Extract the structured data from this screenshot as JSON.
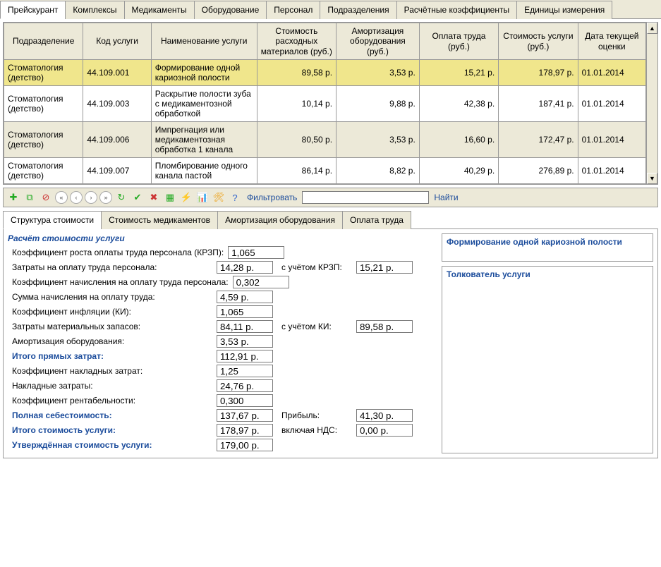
{
  "tabs": {
    "main": [
      "Прейскурант",
      "Комплексы",
      "Медикаменты",
      "Оборудование",
      "Персонал",
      "Подразделения",
      "Расчётные коэффициенты",
      "Единицы измерения"
    ],
    "sub": [
      "Структура стоимости",
      "Стоимость медикаментов",
      "Амортизация оборудования",
      "Оплата труда"
    ]
  },
  "grid": {
    "headers": [
      "Подразделение",
      "Код услуги",
      "Наименование услуги",
      "Стоимость расходных материалов (руб.)",
      "Амортизация оборудования (руб.)",
      "Оплата труда (руб.)",
      "Стоимость услуги (руб.)",
      "Дата текущей оценки"
    ],
    "rows": [
      {
        "dept": "Стоматология (детство)",
        "code": "44.109.001",
        "name": "Формирование одной кариозной полости",
        "mat": "89,58 р.",
        "amort": "3,53 р.",
        "labor": "15,21 р.",
        "cost": "178,97 р.",
        "date": "01.01.2014"
      },
      {
        "dept": "Стоматология (детство)",
        "code": "44.109.003",
        "name": "Раскрытие полости зуба с медикаментозной обработкой",
        "mat": "10,14 р.",
        "amort": "9,88 р.",
        "labor": "42,38 р.",
        "cost": "187,41 р.",
        "date": "01.01.2014"
      },
      {
        "dept": "Стоматология (детство)",
        "code": "44.109.006",
        "name": "Импрегнация или медикаментозная обработка 1 канала",
        "mat": "80,50 р.",
        "amort": "3,53 р.",
        "labor": "16,60 р.",
        "cost": "172,47 р.",
        "date": "01.01.2014"
      },
      {
        "dept": "Стоматология (детство)",
        "code": "44.109.007",
        "name": "Пломбирование одного канала пастой",
        "mat": "86,14 р.",
        "amort": "8,82 р.",
        "labor": "40,29 р.",
        "cost": "276,89 р.",
        "date": "01.01.2014"
      }
    ]
  },
  "toolbar": {
    "filter_label": "Фильтровать",
    "find_label": "Найти"
  },
  "detail": {
    "title": "Расчёт стоимости услуги",
    "rows": [
      {
        "label": "Коэффициент роста оплаты труда персонала (КРЗП):",
        "v1": "1,065"
      },
      {
        "label": "Затраты на оплату труда персонала:",
        "v1": "14,28 р.",
        "mid": "с учётом КРЗП:",
        "v2": "15,21 р."
      },
      {
        "label": "Коэффициент начисления на оплату труда персонала:",
        "v1": "0,302"
      },
      {
        "label": "Сумма начисления на оплату труда:",
        "v1": "4,59 р."
      },
      {
        "label": "Коэффициент инфляции (КИ):",
        "v1": "1,065"
      },
      {
        "label": "Затраты материальных запасов:",
        "v1": "84,11 р.",
        "mid": "с учётом КИ:",
        "v2": "89,58 р."
      },
      {
        "label": "Амортизация оборудования:",
        "v1": "3,53 р."
      },
      {
        "label": "Итого прямых затрат:",
        "v1": "112,91 р.",
        "bold": true
      },
      {
        "label": "Коэффициент накладных затрат:",
        "v1": "1,25"
      },
      {
        "label": "Накладные затраты:",
        "v1": "24,76 р."
      },
      {
        "label": "Коэффициент рентабельности:",
        "v1": "0,300"
      },
      {
        "label": "Полная себестоимость:",
        "v1": "137,67 р.",
        "mid": "Прибыль:",
        "v2": "41,30 р.",
        "bold": true
      },
      {
        "label": "Итого стоимость услуги:",
        "v1": "178,97 р.",
        "mid": "включая НДС:",
        "v2": "0,00 р.",
        "bold": true
      },
      {
        "label": "Утверждённая стоимость услуги:",
        "v1": "179,00 р.",
        "bold": true
      }
    ],
    "right_title": "Формирование одной кариозной полости",
    "right_subtitle": "Толкователь услуги"
  }
}
